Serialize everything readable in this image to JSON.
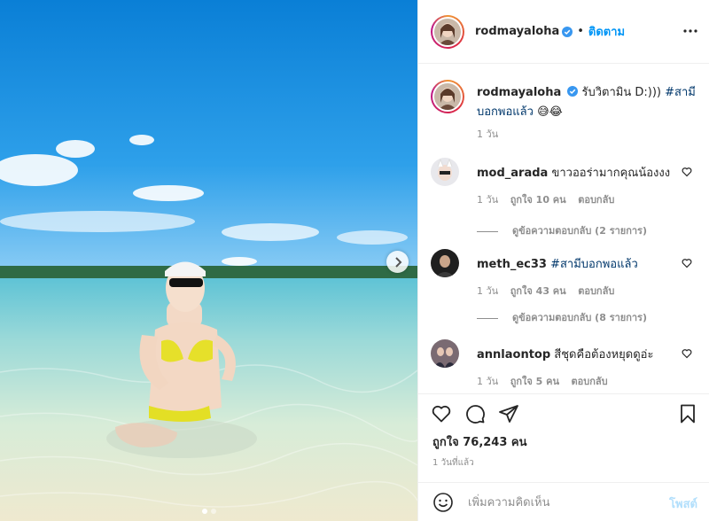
{
  "colors": {
    "accent": "#0095f6",
    "hashtag": "#00376b",
    "muted": "#8e8e8e",
    "text": "#262626"
  },
  "photo": {
    "carousel_count": 2,
    "active_index": 1
  },
  "header": {
    "username": "rodmayaloha",
    "separator": "•",
    "follow_label": "ติดตาม"
  },
  "caption": {
    "username": "rodmayaloha",
    "text": "รับวิตามิน D:)))",
    "hashtag": "#สามีบอกพอแล้ว",
    "emoji": "😅😂",
    "time": "1 วัน"
  },
  "comments": [
    {
      "username": "mod_arada",
      "text": "ขาวออร่ามากคุณน้องงง",
      "time": "1 วัน",
      "likes": "ถูกใจ 10 คน",
      "reply_label": "ตอบกลับ",
      "view_replies": "ดูข้อความตอบกลับ (2 รายการ)"
    },
    {
      "username": "meth_ec33",
      "text": "#สามีบอกพอแล้ว",
      "time": "1 วัน",
      "likes": "ถูกใจ 43 คน",
      "reply_label": "ตอบกลับ",
      "view_replies": "ดูข้อความตอบกลับ (8 รายการ)"
    },
    {
      "username": "annlaontop",
      "text": "สีชุดคือต้องหยุดดูอ่ะ",
      "time": "1 วัน",
      "likes": "ถูกใจ 5 คน",
      "reply_label": "ตอบกลับ"
    }
  ],
  "likes_text": "ถูกใจ 76,243 คน",
  "post_time": "1 วันที่แล้ว",
  "add_comment": {
    "placeholder": "เพิ่มความคิดเห็น",
    "post_label": "โพสต์"
  },
  "icons": [
    "verified-badge-icon",
    "more-options-icon",
    "heart-icon",
    "comment-icon",
    "share-icon",
    "bookmark-icon",
    "emoji-icon",
    "chevron-right-icon"
  ]
}
